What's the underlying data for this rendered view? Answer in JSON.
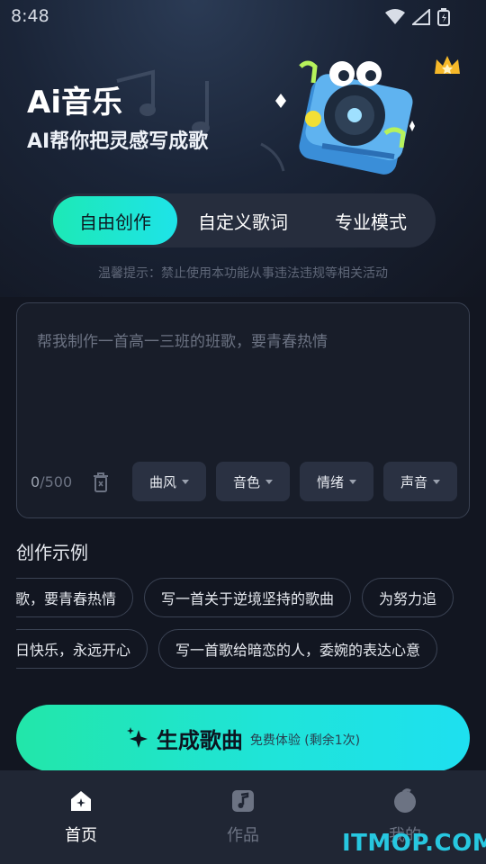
{
  "status_bar": {
    "time": "8:48"
  },
  "header": {
    "title": "Ai音乐",
    "subtitle": "AI帮你把灵感写成歌"
  },
  "mode_tabs": [
    {
      "label": "自由创作",
      "active": true
    },
    {
      "label": "自定义歌词",
      "active": false
    },
    {
      "label": "专业模式",
      "active": false
    }
  ],
  "tip": "温馨提示：禁止使用本功能从事违法违规等相关活动",
  "prompt": {
    "placeholder": "帮我制作一首高一三班的班歌，要青春热情",
    "count_current": "0",
    "count_max": "/500",
    "options": [
      "曲风",
      "音色",
      "情绪",
      "声音"
    ]
  },
  "examples": {
    "heading": "创作示例",
    "row1": [
      "歌，要青春热情",
      "写一首关于逆境坚持的歌曲",
      "为努力追"
    ],
    "row2": [
      "日快乐，永远开心",
      "写一首歌给暗恋的人，委婉的表达心意"
    ]
  },
  "generate": {
    "label": "生成歌曲",
    "sublabel": "免费体验 (剩余1次)"
  },
  "bottom_nav": [
    {
      "label": "首页",
      "active": true
    },
    {
      "label": "作品",
      "active": false
    },
    {
      "label": "我的",
      "active": false
    }
  ],
  "watermark": "ITMOP.COM",
  "colors": {
    "accent_start": "#1de9b6",
    "accent_end": "#1ee3e8",
    "background": "#121621"
  }
}
